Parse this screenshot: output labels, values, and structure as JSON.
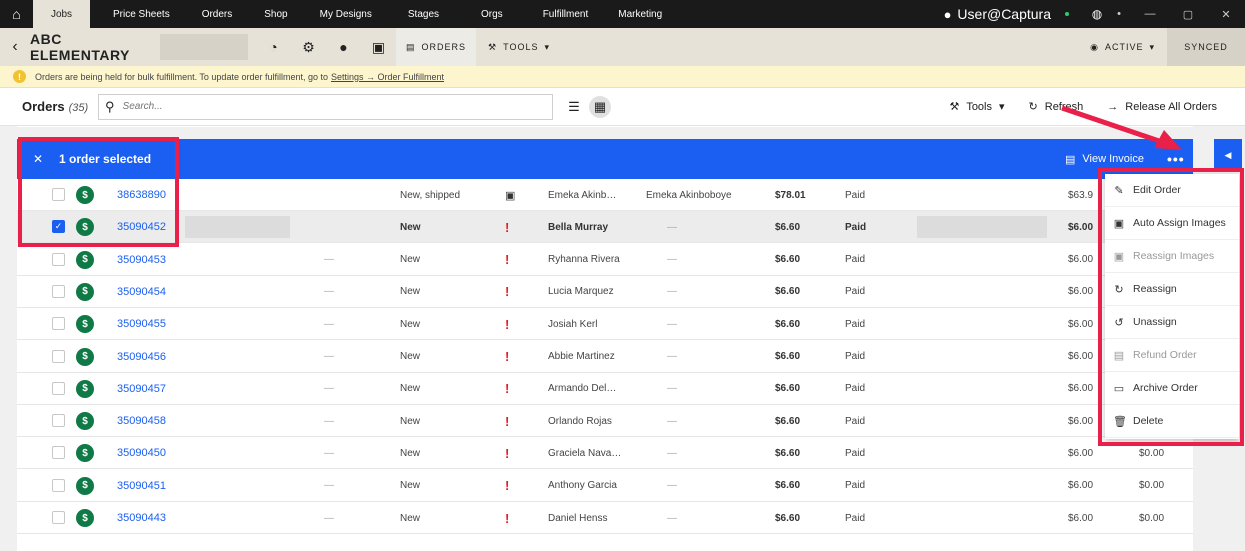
{
  "topnav": {
    "tabs": [
      "Jobs",
      "Price Sheets",
      "Orders",
      "Shop",
      "My Designs",
      "Stages",
      "Orgs",
      "Fulfillment",
      "Marketing"
    ],
    "active_tab": "Jobs",
    "user": "User@Captura"
  },
  "jobbar": {
    "title": "ABC ELEMENTARY",
    "orders_tab": "ORDERS",
    "tools_menu": "TOOLS",
    "status": "ACTIVE",
    "sync_status": "SYNCED"
  },
  "notice": {
    "text": "Orders are being held for bulk fulfillment. To update order fulfillment, go to",
    "link": "Settings → Order Fulfillment"
  },
  "toolbar": {
    "heading": "Orders",
    "count": "(35)",
    "search_placeholder": "Search...",
    "tools": "Tools",
    "refresh": "Refresh",
    "release": "Release All Orders"
  },
  "selection": {
    "label": "1 order selected",
    "view_invoice": "View Invoice",
    "more": "•••"
  },
  "rows": [
    {
      "order": "38638890",
      "dash1": "",
      "status": "New, shipped",
      "flag": "image",
      "customer": "Emeka Akinb…",
      "customer2": "Emeka Akinboboye",
      "total": "$78.01",
      "paid": "Paid",
      "amt1": "$63.9",
      "amt2": "",
      "checked": false,
      "selected": false
    },
    {
      "order": "35090452",
      "dash1": "",
      "status": "New",
      "flag": "!",
      "customer": "Bella Murray",
      "customer2": "—",
      "total": "$6.60",
      "paid": "Paid",
      "amt1": "$6.00",
      "amt2": "",
      "checked": true,
      "selected": true
    },
    {
      "order": "35090453",
      "dash1": "—",
      "status": "New",
      "flag": "!",
      "customer": "Ryhanna Rivera",
      "customer2": "—",
      "total": "$6.60",
      "paid": "Paid",
      "amt1": "$6.00",
      "amt2": "",
      "checked": false,
      "selected": false
    },
    {
      "order": "35090454",
      "dash1": "—",
      "status": "New",
      "flag": "!",
      "customer": "Lucia Marquez",
      "customer2": "—",
      "total": "$6.60",
      "paid": "Paid",
      "amt1": "$6.00",
      "amt2": "",
      "checked": false,
      "selected": false
    },
    {
      "order": "35090455",
      "dash1": "—",
      "status": "New",
      "flag": "!",
      "customer": "Josiah Kerl",
      "customer2": "—",
      "total": "$6.60",
      "paid": "Paid",
      "amt1": "$6.00",
      "amt2": "",
      "checked": false,
      "selected": false
    },
    {
      "order": "35090456",
      "dash1": "—",
      "status": "New",
      "flag": "!",
      "customer": "Abbie Martinez",
      "customer2": "—",
      "total": "$6.60",
      "paid": "Paid",
      "amt1": "$6.00",
      "amt2": "",
      "checked": false,
      "selected": false
    },
    {
      "order": "35090457",
      "dash1": "—",
      "status": "New",
      "flag": "!",
      "customer": "Armando Del…",
      "customer2": "—",
      "total": "$6.60",
      "paid": "Paid",
      "amt1": "$6.00",
      "amt2": "",
      "checked": false,
      "selected": false
    },
    {
      "order": "35090458",
      "dash1": "—",
      "status": "New",
      "flag": "!",
      "customer": "Orlando Rojas",
      "customer2": "—",
      "total": "$6.60",
      "paid": "Paid",
      "amt1": "$6.00",
      "amt2": "",
      "checked": false,
      "selected": false
    },
    {
      "order": "35090450",
      "dash1": "—",
      "status": "New",
      "flag": "!",
      "customer": "Graciela Nava…",
      "customer2": "—",
      "total": "$6.60",
      "paid": "Paid",
      "amt1": "$6.00",
      "amt2": "$0.00",
      "checked": false,
      "selected": false
    },
    {
      "order": "35090451",
      "dash1": "—",
      "status": "New",
      "flag": "!",
      "customer": "Anthony Garcia",
      "customer2": "—",
      "total": "$6.60",
      "paid": "Paid",
      "amt1": "$6.00",
      "amt2": "$0.00",
      "checked": false,
      "selected": false
    },
    {
      "order": "35090443",
      "dash1": "—",
      "status": "New",
      "flag": "!",
      "customer": "Daniel Henss",
      "customer2": "—",
      "total": "$6.60",
      "paid": "Paid",
      "amt1": "$6.00",
      "amt2": "$0.00",
      "checked": false,
      "selected": false
    }
  ],
  "menu": [
    {
      "label": "Edit Order",
      "icon": "pencil-icon",
      "disabled": false
    },
    {
      "label": "Auto Assign Images",
      "icon": "image-icon",
      "disabled": false
    },
    {
      "label": "Reassign Images",
      "icon": "image-icon",
      "disabled": true
    },
    {
      "label": "Reassign",
      "icon": "redo-icon",
      "disabled": false
    },
    {
      "label": "Unassign",
      "icon": "undo-icon",
      "disabled": false
    },
    {
      "label": "Refund Order",
      "icon": "invoice-icon",
      "disabled": true
    },
    {
      "label": "Archive Order",
      "icon": "archive-icon",
      "disabled": false
    },
    {
      "label": "Delete",
      "icon": "trash-icon",
      "disabled": false
    }
  ],
  "colors": {
    "accent": "#1a5ef2",
    "annotation": "#e8204a",
    "paid_icon": "#0f7a45",
    "flag": "#e0202e"
  }
}
